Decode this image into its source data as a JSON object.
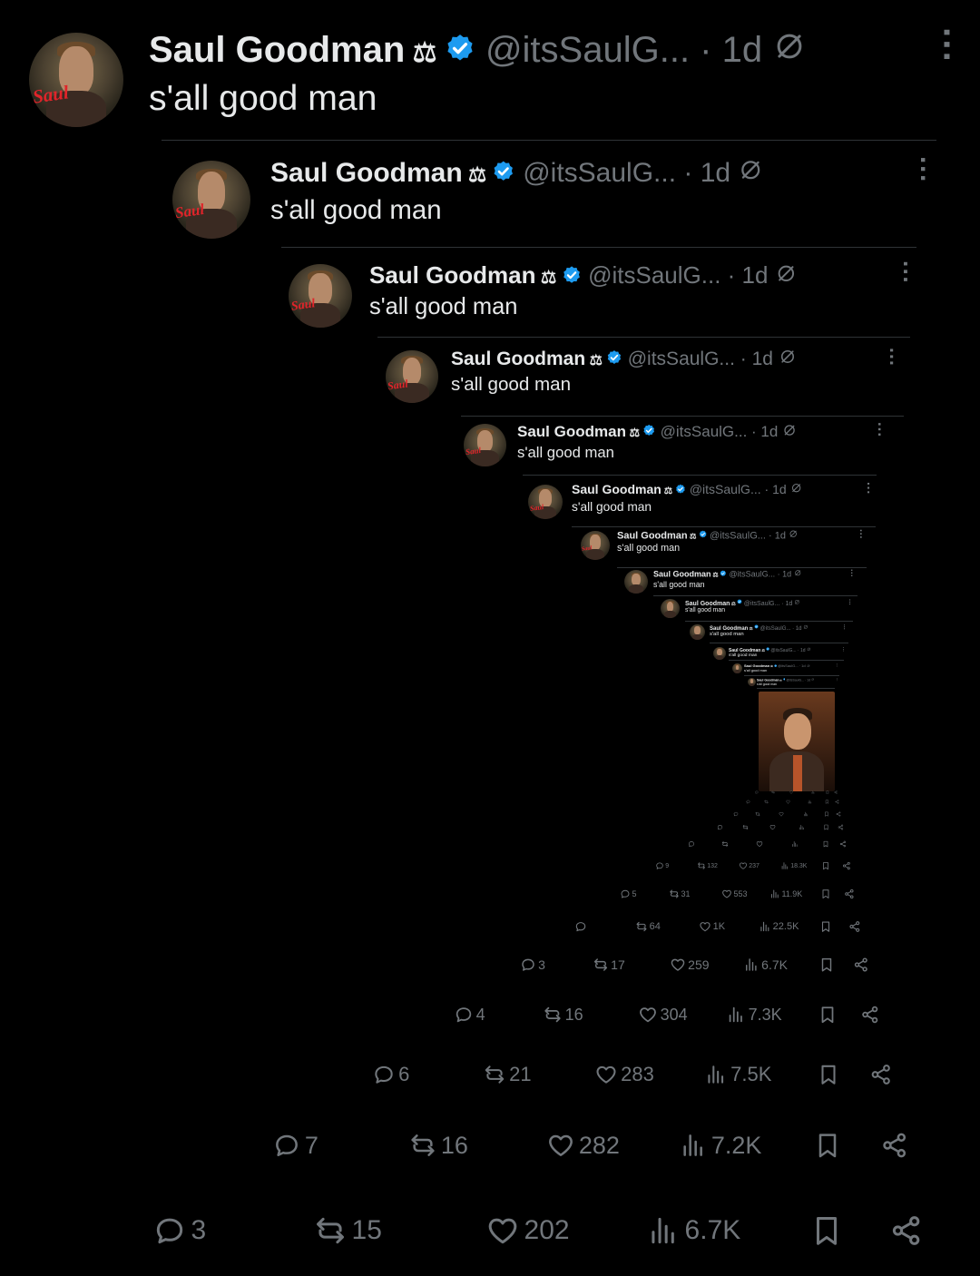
{
  "tweet": {
    "name": "Saul Goodman",
    "name_emoji": "⚖",
    "handle": "@itsSaulG...",
    "time": "· 1d",
    "text": "s'all good man",
    "avatar_logo_text": "Saul"
  },
  "colors": {
    "background": "#000000",
    "text": "#e7e9ea",
    "muted": "#71767b",
    "verified": "#1d9bf0",
    "divider": "#2f3336"
  },
  "levels": [
    {
      "replies": "3",
      "reposts": "15",
      "likes": "202",
      "views": "6.7K"
    },
    {
      "replies": "7",
      "reposts": "16",
      "likes": "282",
      "views": "7.2K"
    },
    {
      "replies": "6",
      "reposts": "21",
      "likes": "283",
      "views": "7.5K"
    },
    {
      "replies": "4",
      "reposts": "16",
      "likes": "304",
      "views": "7.3K"
    },
    {
      "replies": "3",
      "reposts": "17",
      "likes": "259",
      "views": "6.7K"
    },
    {
      "replies": "",
      "reposts": "64",
      "likes": "1K",
      "views": "22.5K"
    },
    {
      "replies": "5",
      "reposts": "31",
      "likes": "553",
      "views": "11.9K"
    },
    {
      "replies": "9",
      "reposts": "132",
      "likes": "237",
      "views": "18.3K"
    }
  ],
  "icons": [
    "verified-badge-icon",
    "no-notifications-icon",
    "more-icon",
    "reply-icon",
    "repost-icon",
    "like-icon",
    "views-icon",
    "bookmark-icon",
    "share-icon"
  ]
}
